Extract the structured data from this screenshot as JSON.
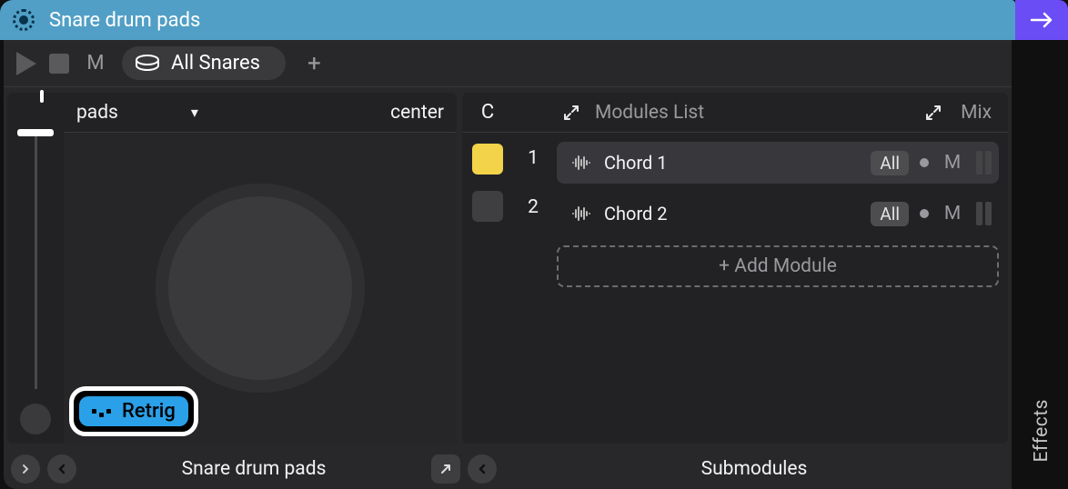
{
  "window": {
    "title": "Snare drum pads"
  },
  "side": {
    "arrow_label": "Next",
    "effects": "Effects"
  },
  "transport": {
    "mute": "M",
    "tab_label": "All Snares",
    "add_tab": "+"
  },
  "left": {
    "selector": "pads",
    "mode": "center",
    "retrig": "Retrig"
  },
  "right": {
    "color_header": "C",
    "list_header": "Modules List",
    "mix_header": "Mix",
    "modules": [
      {
        "idx": "1",
        "name": "Chord 1",
        "scope": "All",
        "mute": "M"
      },
      {
        "idx": "2",
        "name": "Chord 2",
        "scope": "All",
        "mute": "M"
      }
    ],
    "add": "+ Add Module"
  },
  "footer": {
    "left_label": "Snare drum pads",
    "right_label": "Submodules"
  }
}
